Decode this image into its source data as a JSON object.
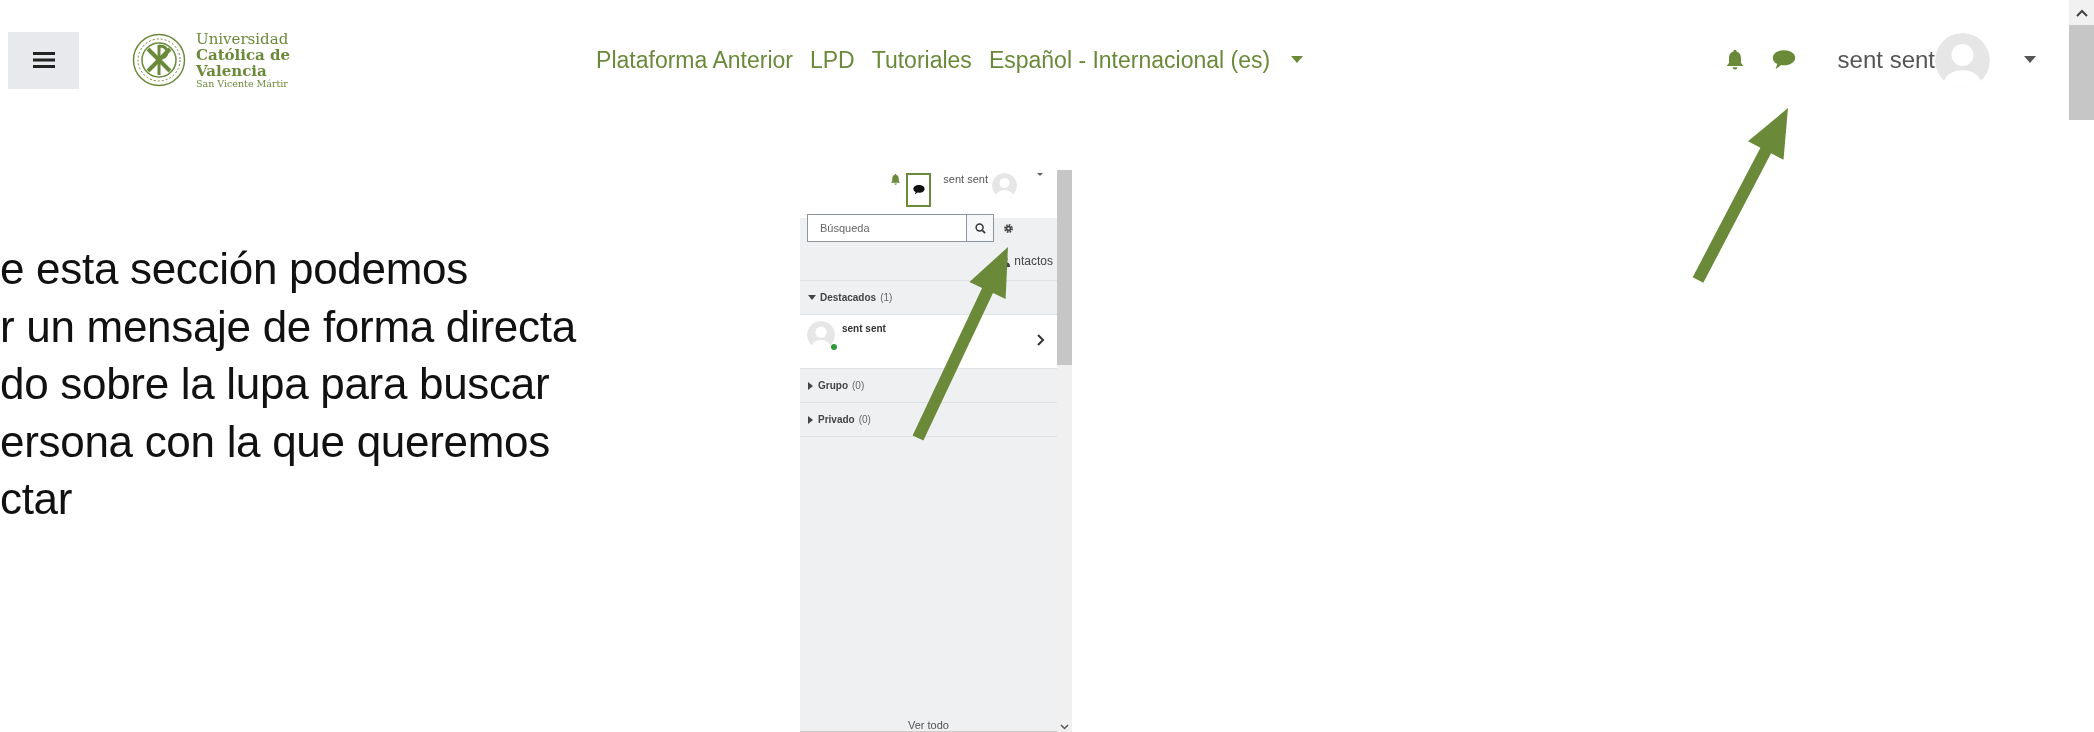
{
  "header": {
    "logo": {
      "lines": [
        {
          "text": "Universidad",
          "kind": "light"
        },
        {
          "text": "Católica de",
          "kind": "bold"
        },
        {
          "text": "Valencia",
          "kind": "bold"
        },
        {
          "text": "San Vicente Mártir",
          "kind": "small"
        }
      ]
    },
    "nav": [
      {
        "label": "Plataforma Anterior",
        "kind": "link"
      },
      {
        "label": "LPD",
        "kind": "link"
      },
      {
        "label": "Tutoriales",
        "kind": "link"
      },
      {
        "label": "Español - Internacional (es)",
        "kind": "dropdown"
      }
    ],
    "user": {
      "name": "sent sent"
    }
  },
  "instructions": {
    "lines": [
      "e esta sección podemos",
      "r un mensaje de forma directa",
      "do sobre la lupa para buscar",
      "ersona con la que queremos",
      "ctar"
    ]
  },
  "inset": {
    "user": {
      "name": "sent sent"
    },
    "messages_open": true,
    "search": {
      "placeholder": "Búsqueda"
    },
    "contacts_link": "ntactos",
    "sections": [
      {
        "label": "Destacados",
        "count": "(1)",
        "expanded": true,
        "contacts": [
          {
            "name": "sent sent",
            "online": true
          }
        ]
      },
      {
        "label": "Grupo",
        "count": "(0)",
        "expanded": false
      },
      {
        "label": "Privado",
        "count": "(0)",
        "expanded": false
      }
    ],
    "footer_link": "Ver todo"
  }
}
